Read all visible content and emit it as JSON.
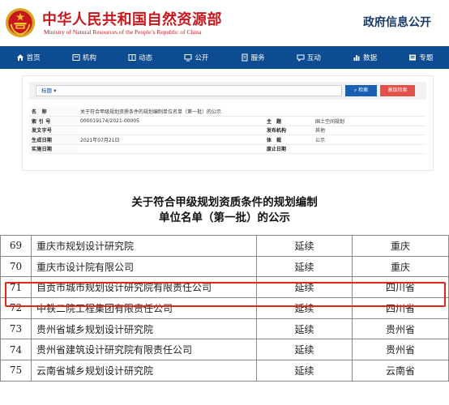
{
  "header": {
    "title": "中华人民共和国自然资源部",
    "subtitle": "Ministry of Natural Resources of the People’s Republic of China",
    "section": "政府信息公开"
  },
  "nav": [
    {
      "label": "首页",
      "icon": "home-icon"
    },
    {
      "label": "机构",
      "icon": "building-icon"
    },
    {
      "label": "动态",
      "icon": "news-icon"
    },
    {
      "label": "公开",
      "icon": "monitor-icon"
    },
    {
      "label": "服务",
      "icon": "document-icon"
    },
    {
      "label": "互动",
      "icon": "chat-icon"
    },
    {
      "label": "数据",
      "icon": "chart-icon"
    },
    {
      "label": "专题",
      "icon": "topic-icon"
    }
  ],
  "search": {
    "field_label": "标题 ▾",
    "search_button": "检索",
    "advanced_button": "高级检索"
  },
  "meta": {
    "rows": [
      {
        "k1": "名　称",
        "v1": "关于符合甲级规划资质条件的规划编制单位名单（第一批）的公示",
        "k2": "",
        "v2": ""
      },
      {
        "k1": "索 引 号",
        "v1": "000019174/2021-00005",
        "k2": "主　题",
        "v2": "国土空间规划"
      },
      {
        "k1": "发文字号",
        "v1": "",
        "k2": "发布机构",
        "v2": "其他"
      },
      {
        "k1": "生成日期",
        "v1": "2021年07月21日",
        "k2": "体　裁",
        "v2": "公示"
      },
      {
        "k1": "实施日期",
        "v1": "",
        "k2": "废止日期",
        "v2": ""
      }
    ]
  },
  "doc": {
    "title_line1": "关于符合甲级规划资质条件的规划编制",
    "title_line2": "单位名单（第一批）的公示"
  },
  "list": {
    "rows": [
      {
        "no": "69",
        "name": "重庆市规划设计研究院",
        "type": "延续",
        "prov": "重庆"
      },
      {
        "no": "70",
        "name": "重庆市设计院有限公司",
        "type": "延续",
        "prov": "重庆"
      },
      {
        "no": "71",
        "name": "自贡市城市规划设计研究院有限责任公司",
        "type": "延续",
        "prov": "四川省"
      },
      {
        "no": "72",
        "name": "中铁二院工程集团有限责任公司",
        "type": "延续",
        "prov": "四川省"
      },
      {
        "no": "73",
        "name": "贵州省城乡规划设计研究院",
        "type": "延续",
        "prov": "贵州省"
      },
      {
        "no": "74",
        "name": "贵州省建筑设计研究院有限责任公司",
        "type": "延续",
        "prov": "贵州省"
      },
      {
        "no": "75",
        "name": "云南省城乡规划设计研究院",
        "type": "延续",
        "prov": "云南省"
      }
    ]
  },
  "colors": {
    "brand_red": "#c8161d",
    "nav_blue": "#0e4c92",
    "highlight_red": "#e3261c"
  }
}
